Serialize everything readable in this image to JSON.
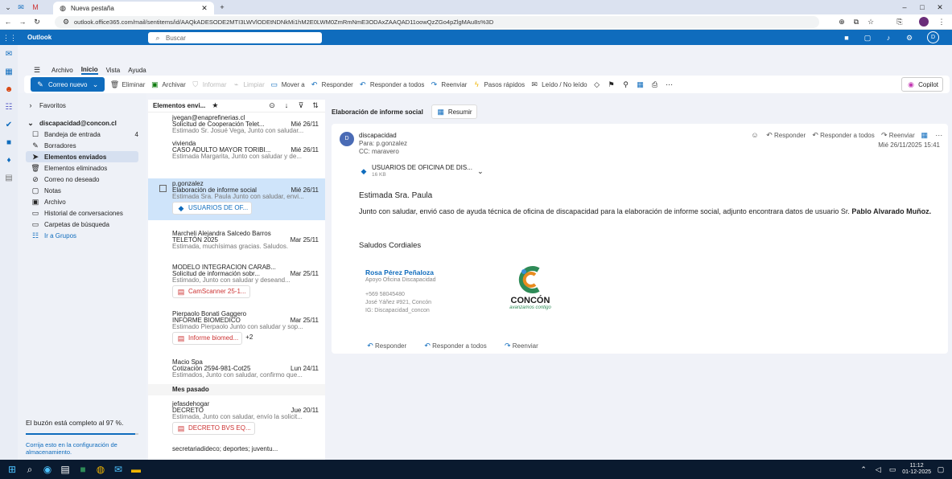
{
  "browser": {
    "tab_title": "Nueva pestaña",
    "url": "outlook.office365.com/mail/sentitems/id/AAQkADESODE2MTI3LWVlODEtNDNkMi1hM2E0LWM0ZmRmNmE3ODAxZAAQAD11oowQzZGo4pZlgMAu8s%3D"
  },
  "outlook": {
    "app_name": "Outlook",
    "search_placeholder": "Buscar",
    "menu": [
      "Archivo",
      "Inicio",
      "Vista",
      "Ayuda"
    ],
    "ribbon": {
      "new_mail": "Correo nuevo",
      "delete": "Eliminar",
      "archive": "Archivar",
      "report": "Informar",
      "sweep": "Limpiar",
      "move": "Mover a",
      "reply": "Responder",
      "reply_all": "Responder a todos",
      "forward": "Reenviar",
      "quick_steps": "Pasos rápidos",
      "read_unread": "Leído / No leído",
      "copilot": "Copilot"
    }
  },
  "folders": {
    "favorites": "Favoritos",
    "account": "discapacidad@concon.cl",
    "items": [
      {
        "label": "Bandeja de entrada",
        "count": "4"
      },
      {
        "label": "Borradores",
        "count": ""
      },
      {
        "label": "Elementos enviados",
        "count": ""
      },
      {
        "label": "Elementos eliminados",
        "count": ""
      },
      {
        "label": "Correo no deseado",
        "count": ""
      },
      {
        "label": "Notas",
        "count": ""
      },
      {
        "label": "Archivo",
        "count": ""
      },
      {
        "label": "Historial de conversaciones",
        "count": ""
      },
      {
        "label": "Carpetas de búsqueda",
        "count": ""
      }
    ],
    "groups": "Ir a Grupos",
    "storage_warning": "El buzón está completo al 97 %.",
    "storage_fix": "Corrija esto en la configuración de almacenamiento."
  },
  "list": {
    "header": "Elementos envi...",
    "section_last_month": "Mes pasado",
    "messages": [
      {
        "to": "jvegan@enaprefinerias.cl",
        "subject": "Solicitud de Cooperación Telet...",
        "date": "Mié 26/11",
        "preview": "Estimado Sr. Josué Vega, Junto con saludar...",
        "attachment": ""
      },
      {
        "to": "vivienda",
        "subject": "CASO ADULTO MAYOR TORIBI...",
        "date": "Mié 26/11",
        "preview": "Estimada Margarita, Junto con saludar y de...",
        "attachment": ""
      },
      {
        "to": "p.gonzalez",
        "subject": "Elaboración de informe social",
        "date": "Mié 26/11",
        "preview": "Estimada Sra. Paula Junto con saludar, envi...",
        "attachment": "USUARIOS DE OF..."
      },
      {
        "to": "Marcheli Alejandra Salcedo Barros",
        "subject": "TELETÓN 2025",
        "date": "Mar 25/11",
        "preview": "Estimada, muchísimas gracias. Saludos.",
        "attachment": ""
      },
      {
        "to": "MODELO INTEGRACION CARAB...",
        "subject": "Solicitud de información sobr...",
        "date": "Mar 25/11",
        "preview": "Estimado, Junto con saludar y deseand...",
        "attachment": "CamScanner 25-1..."
      },
      {
        "to": "Pierpaolo Bonati Gaggero",
        "subject": "INFORME BIOMEDICO",
        "date": "Mar 25/11",
        "preview": "Estimado Pierpaolo Junto con saludar y sop...",
        "attachment": "Informe biomed...",
        "extra": "+2"
      },
      {
        "to": "Macio Spa",
        "subject": "Cotización 2594-981-Cot25",
        "date": "Lun 24/11",
        "preview": "Estimados, Junto con saludar, confirmo que...",
        "attachment": ""
      },
      {
        "to": "jefasdehogar",
        "subject": "DECRETO",
        "date": "Jue 20/11",
        "preview": "Estimada, Junto con saludar, envío la solicit...",
        "attachment": "DECRETO BVS EQ..."
      },
      {
        "to": "secretariadideco; deportes; juventu...",
        "subject": "",
        "date": "",
        "preview": "",
        "attachment": ""
      }
    ]
  },
  "reading": {
    "subject": "Elaboración de informe social",
    "summary": "Resumir",
    "from": "discapacidad",
    "to_line": "Para: p.gonzalez",
    "cc_line": "CC: maravero",
    "timestamp": "Mié 26/11/2025 15:41",
    "attachment_name": "USUARIOS DE OFICINA DE DIS...",
    "attachment_size": "16 KB",
    "reply": "Responder",
    "reply_all": "Responder a todos",
    "forward": "Reenviar",
    "greeting": "Estimada Sra. Paula",
    "body_text": "Junto con saludar, envió caso de ayuda técnica de oficina de discapacidad para la elaboración de informe social, adjunto encontrara datos de usuario Sr.",
    "body_bold": "Pablo Alvarado Muñoz.",
    "closing": "Saludos Cordiales",
    "sig_name": "Rosa Pérez Peñaloza",
    "sig_role": "Apoyo Oficina Discapacidad",
    "sig_phone": "+569 58045480",
    "sig_address": "José Yáñez #921, Concón",
    "sig_ig": "IG: Discapacidad_concon",
    "logo_text": "CONCÓN",
    "logo_tagline": "avanzamos contigo"
  },
  "taskbar": {
    "time": "11:12",
    "date": "01-12-2025"
  },
  "colors": {
    "accent": "#0f6cbd",
    "selected_row": "#cfe4fa",
    "taskbar": "#0a1a2f"
  }
}
